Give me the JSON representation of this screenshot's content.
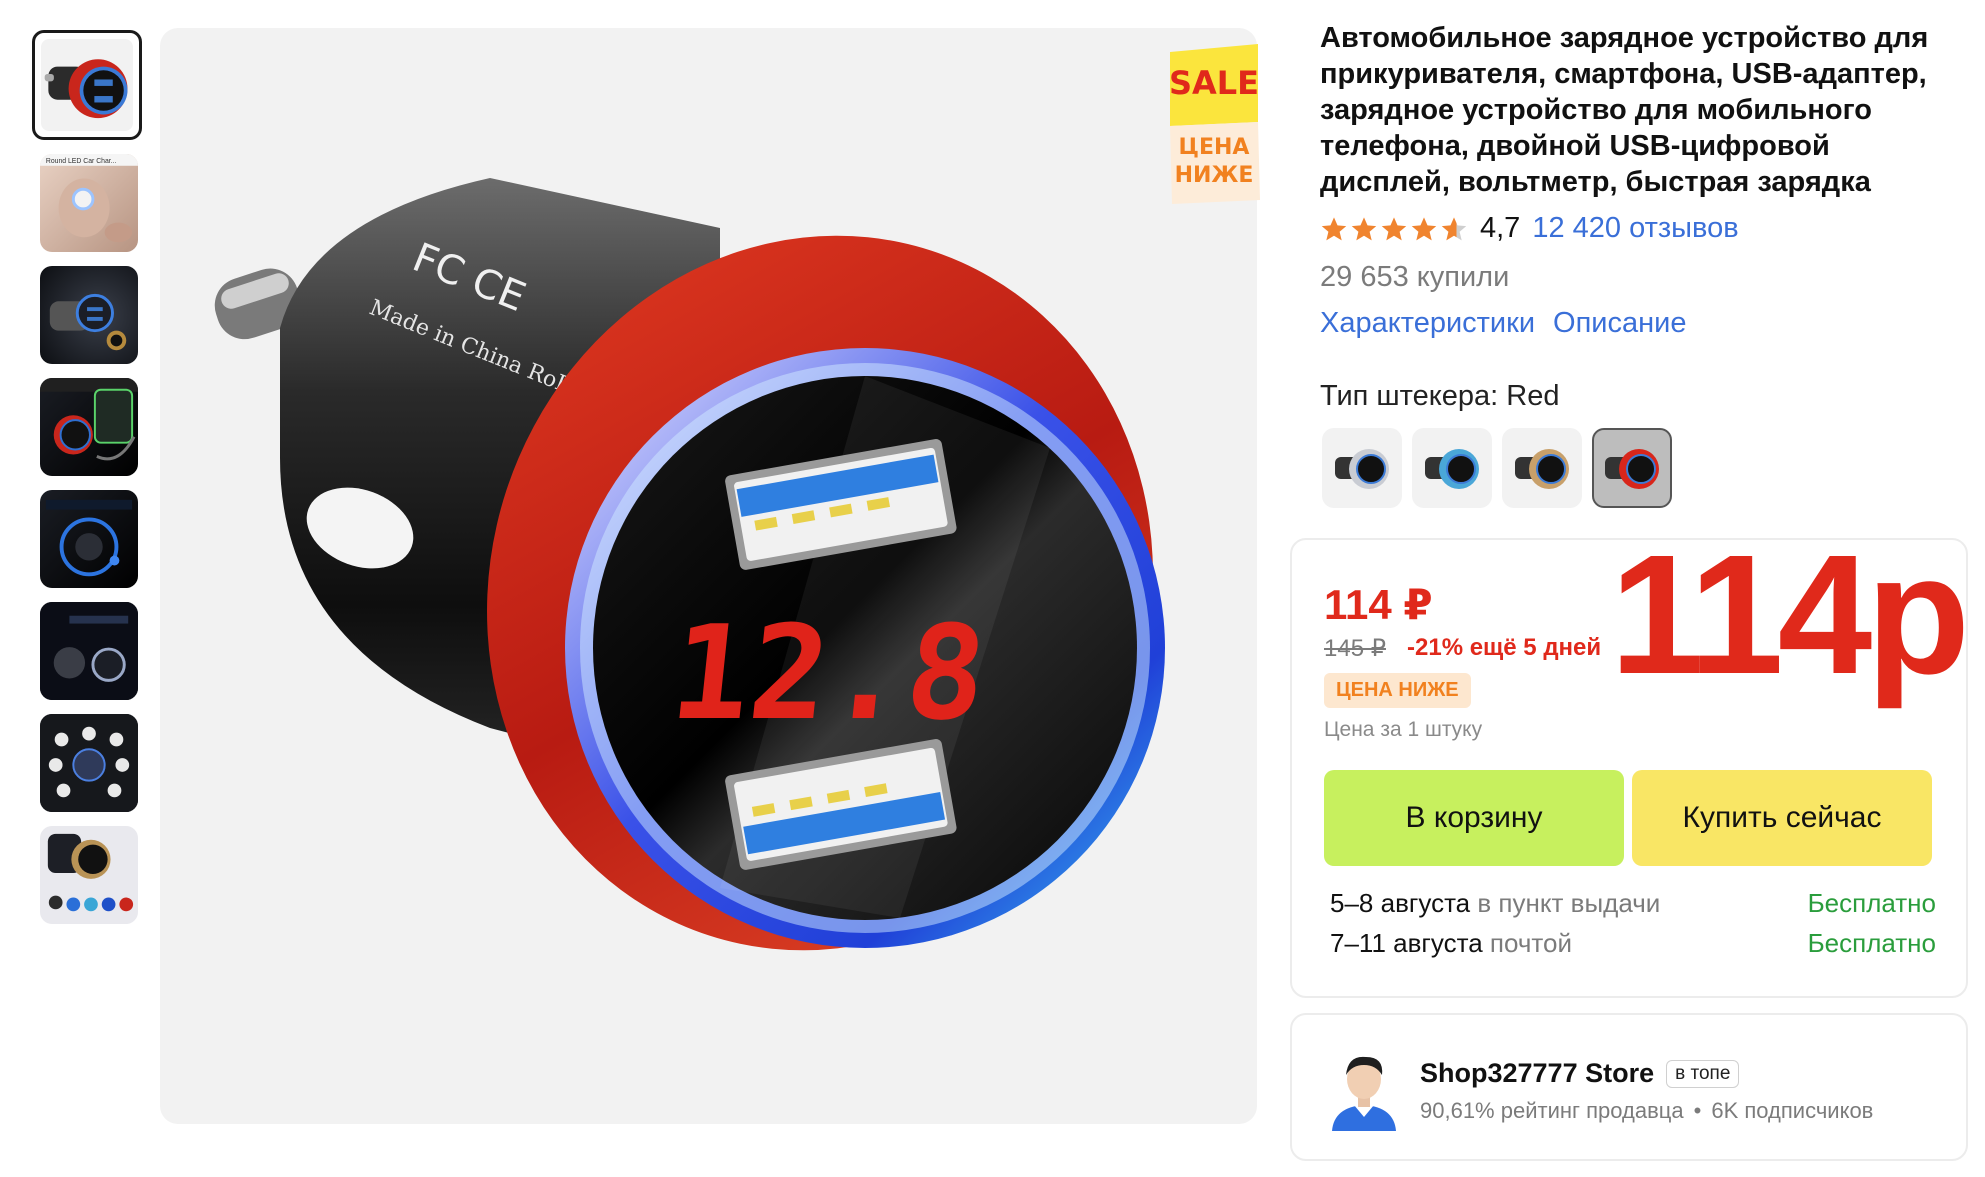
{
  "product": {
    "title": "Автомобильное зарядное устройство для прикуривателя, смартфона, USB-адаптер, зарядное устройство для мобильного телефона, двойной USB-цифровой дисплей, вольтметр, быстрая зарядка",
    "rating_value": "4,7",
    "rating_stars": 4.7,
    "reviews": "12 420 отзывов",
    "bought": "29 653 купили",
    "links": [
      "Характеристики",
      "Описание"
    ],
    "plug_type_label": "Тип штекера: Red",
    "display_reading": "12.8",
    "variants": [
      {
        "name": "silver",
        "accent": "#c9ccd3"
      },
      {
        "name": "blue",
        "accent": "#4aa7d8"
      },
      {
        "name": "gold",
        "accent": "#c8a06a"
      },
      {
        "name": "red",
        "accent": "#d8261b",
        "selected": true
      }
    ]
  },
  "gallery": {
    "thumbnail_count": 8,
    "thumbnail_caption_2": "Round LED Car Char..."
  },
  "badge": {
    "sale": "SALE",
    "line1": "ЦЕНА",
    "line2": "НИЖЕ"
  },
  "price": {
    "current": "114 ₽",
    "old": "145 ₽",
    "discount": "-21% ещё 5 дней",
    "overlay": "114р",
    "lower_tag": "ЦЕНА НИЖЕ",
    "per_unit": "Цена за 1 штуку"
  },
  "buttons": {
    "cart": "В корзину",
    "buy_now": "Купить сейчас"
  },
  "delivery": [
    {
      "date": "5–8 августа",
      "method": " в пункт выдачи",
      "cost": "Бесплатно"
    },
    {
      "date": "7–11 августа",
      "method": " почтой",
      "cost": "Бесплатно"
    }
  ],
  "seller": {
    "name": "Shop327777 Store",
    "badge": "в топе",
    "rating": "90,61% рейтинг продавца",
    "separator": "•",
    "followers": "6K подписчиков"
  },
  "colors": {
    "price_red": "#e0291b",
    "link_blue": "#3a6fd8",
    "cart_green": "#c7f05e",
    "buy_yellow": "#f9e665",
    "free_green": "#2a9d3c",
    "star_orange": "#f0842f"
  }
}
